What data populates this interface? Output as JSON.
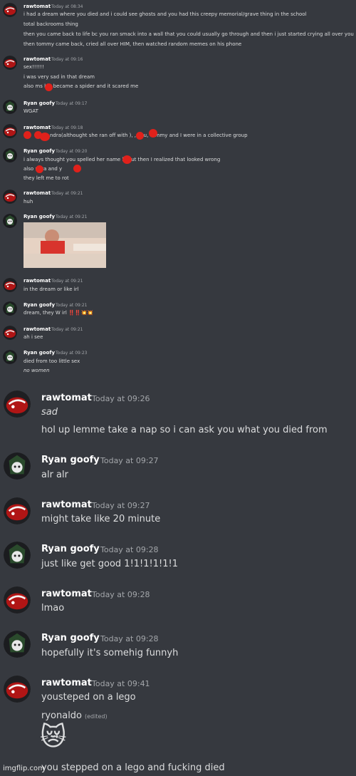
{
  "messages": [
    {
      "author": "rawtomat",
      "time": "Today at 08:34",
      "lines": [
        "i had a dream where you died and i could see ghosts and you had this creepy memorial/grave thing in the school",
        "total backrooms thing",
        "then you came back to life bc you ran smack into a wall that you could usually go through and then i just started crying all over you",
        "then tommy came back, cried all over HIM, then watched random memes on his phone"
      ]
    },
    {
      "author": "rawtomat",
      "time": "Today at 09:16",
      "lines": [
        "sex!!!!!!",
        "i was very sad in that dream",
        "also ms ley became a spider and it scared me"
      ]
    },
    {
      "author": "Ryan goofy",
      "time": "Today at 09:17",
      "lines": [
        "WGAT"
      ]
    },
    {
      "author": "rawtomat",
      "time": "Today at 09:18",
      "lines": [
        "ndra(althought she ran off with  ), , you, tommy and I were in a collective group"
      ]
    },
    {
      "author": "Ryan goofy",
      "time": "Today at 09:20",
      "lines": [
        "i always thought you spelled her name  ly but then I realized that looked wrong",
        "also  ndra and  y",
        "they left me to rot"
      ]
    },
    {
      "author": "rawtomat",
      "time": "Today at 09:21",
      "lines": [
        "huh"
      ]
    },
    {
      "author": "Ryan goofy",
      "time": "Today at 09:21",
      "lines": []
    },
    {
      "author": "rawtomat",
      "time": "Today at 09:21",
      "lines": [
        "in the dream or like irl"
      ]
    },
    {
      "author": "Ryan goofy",
      "time": "Today at 09:21",
      "lines": [
        "dream, they W irl ‼️‼️💥💥"
      ]
    },
    {
      "author": "rawtomat",
      "time": "Today at 09:21",
      "lines": [
        "ah i see"
      ]
    },
    {
      "author": "Ryan goofy",
      "time": "Today at 09:23",
      "lines": [
        "died from too little sex",
        "no women"
      ]
    },
    {
      "author": "rawtomat",
      "time": "Today at 09:26",
      "lines": [
        "sad",
        "hol up lemme take a nap so i can ask you what you died from"
      ]
    },
    {
      "author": "Ryan goofy",
      "time": "Today at 09:27",
      "lines": [
        "alr alr"
      ]
    },
    {
      "author": "rawtomat",
      "time": "Today at 09:27",
      "lines": [
        "might take like 20 minute"
      ]
    },
    {
      "author": "Ryan goofy",
      "time": "Today at 09:28",
      "lines": [
        "just like get good 1!1!1!1!1!1"
      ]
    },
    {
      "author": "rawtomat",
      "time": "Today at 09:28",
      "lines": [
        "lmao"
      ]
    },
    {
      "author": "Ryan goofy",
      "time": "Today at 09:28",
      "lines": [
        "hopefully it's somehig funnyh"
      ]
    },
    {
      "author": "rawtomat",
      "time": "Today at 09:41",
      "lines": [
        "yousteped on a lego",
        "ryonaldo",
        "😿",
        "you stepped on a lego and fucking died"
      ]
    }
  ],
  "edited_label": "(edited)",
  "watermark": "imgflip.com",
  "colors": {
    "background": "#36393f",
    "text": "#dcddde",
    "timestamp": "#a3a6aa",
    "username": "#ffffff",
    "redaction": "#e0211b"
  }
}
